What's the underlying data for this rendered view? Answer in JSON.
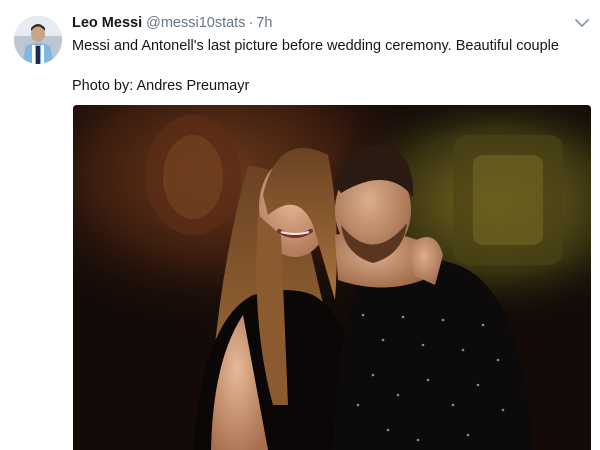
{
  "tweet": {
    "display_name": "Leo Messi",
    "handle": "@messi10stats",
    "separator": "·",
    "time": "7h",
    "text_line1": "Messi and Antonell's last picture before wedding ceremony. Beautiful couple",
    "text_line2": "Photo by: Andres Preumayr"
  },
  "icons": {
    "caret": "chevron-down-icon",
    "avatar": "avatar"
  },
  "colors": {
    "name": "#14171a",
    "secondary": "#657786",
    "caret": "#8899a6",
    "photo_bg": "#140b08"
  }
}
